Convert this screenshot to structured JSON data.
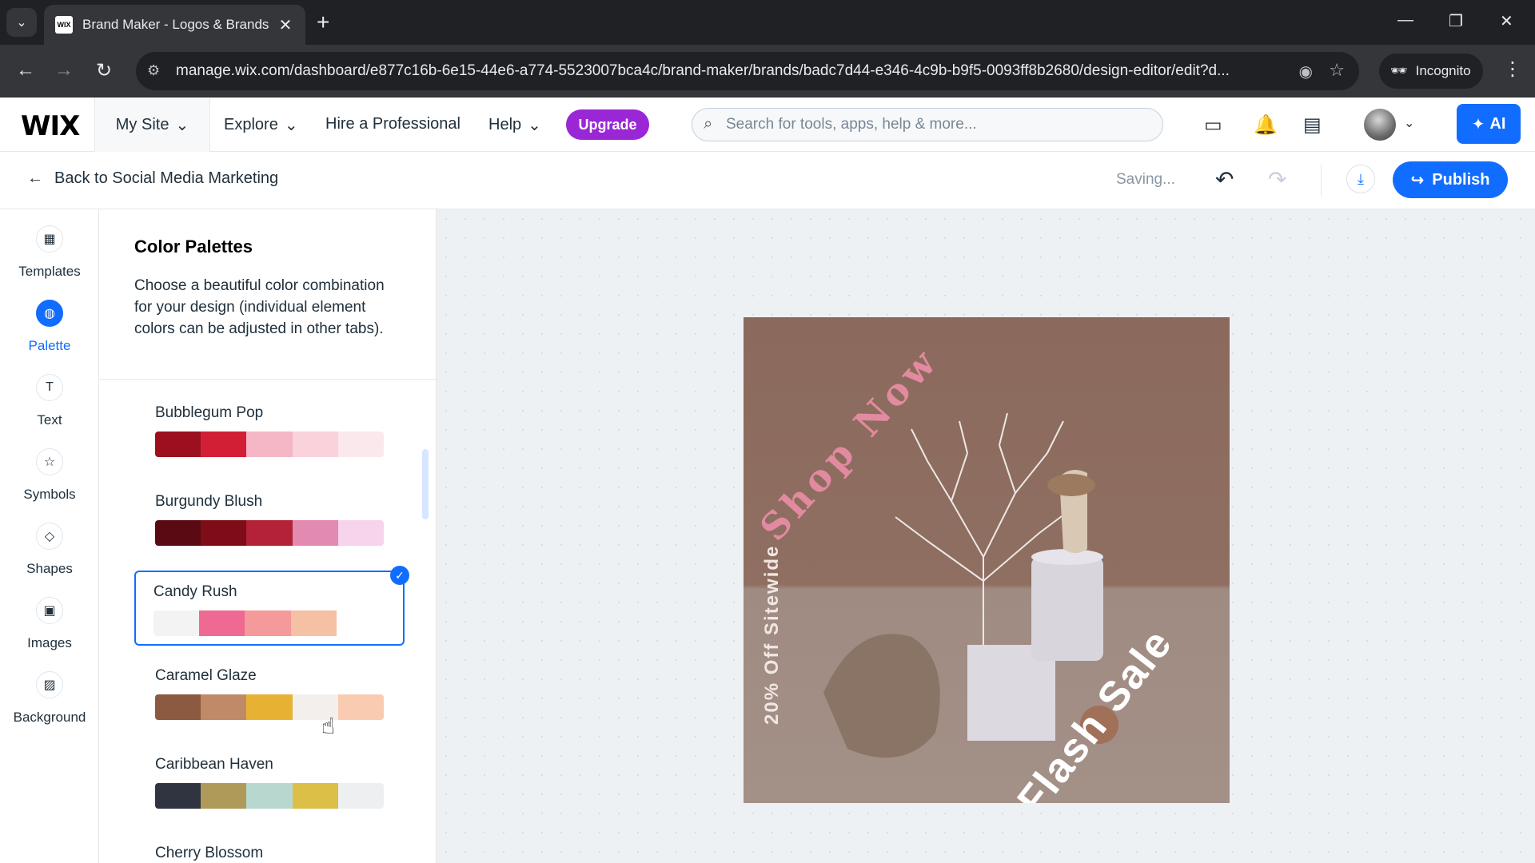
{
  "browser": {
    "tab_title": "Brand Maker - Logos & Brands",
    "favicon_text": "WIX",
    "url": "manage.wix.com/dashboard/e877c16b-6e15-44e6-a774-5523007bca4c/brand-maker/brands/badc7d44-e346-4c9b-b9f5-0093ff8b2680/design-editor/edit?d...",
    "incognito_label": "Incognito"
  },
  "wix_header": {
    "logo": "WIX",
    "my_site": "My Site",
    "explore": "Explore",
    "hire": "Hire a Professional",
    "help": "Help",
    "upgrade": "Upgrade",
    "search_placeholder": "Search for tools, apps, help & more...",
    "ai_label": "AI"
  },
  "editor_bar": {
    "back_label": "Back to Social Media Marketing",
    "status": "Saving...",
    "publish": "Publish"
  },
  "rail": [
    {
      "label": "Templates",
      "icon": "templates-icon"
    },
    {
      "label": "Palette",
      "icon": "palette-icon",
      "active": true
    },
    {
      "label": "Text",
      "icon": "text-icon"
    },
    {
      "label": "Symbols",
      "icon": "star-icon"
    },
    {
      "label": "Shapes",
      "icon": "shapes-icon"
    },
    {
      "label": "Images",
      "icon": "image-icon"
    },
    {
      "label": "Background",
      "icon": "background-icon"
    }
  ],
  "panel": {
    "title": "Color Palettes",
    "description": "Choose a beautiful color combination for your design (individual element colors can be adjusted in other tabs).",
    "palettes": [
      {
        "name": "Bubblegum Pop",
        "colors": [
          "#9c0f1f",
          "#d21f35",
          "#f5b6c6",
          "#f9d2dc",
          "#fbe8ec"
        ]
      },
      {
        "name": "Burgundy Blush",
        "colors": [
          "#5a0a12",
          "#7e0d17",
          "#b32236",
          "#e28ab0",
          "#f8d3ec"
        ]
      },
      {
        "name": "Candy Rush",
        "colors": [
          "#f3f3f3",
          "#ee6a93",
          "#f59a9a",
          "#f6c0a4",
          "#ffffff"
        ],
        "selected": true
      },
      {
        "name": "Caramel Glaze",
        "colors": [
          "#8c5a40",
          "#c08a68",
          "#e7b234",
          "#f3efec",
          "#f9cbb0"
        ]
      },
      {
        "name": "Caribbean Haven",
        "colors": [
          "#2f3440",
          "#b09a5a",
          "#b8d8cf",
          "#dcbf46",
          "#eeeff1"
        ]
      },
      {
        "name": "Cherry Blossom",
        "colors": []
      }
    ]
  },
  "artboard": {
    "headline": "Shop Now",
    "offer": "20% Off Sitewide",
    "sale": "Flash Sale"
  }
}
